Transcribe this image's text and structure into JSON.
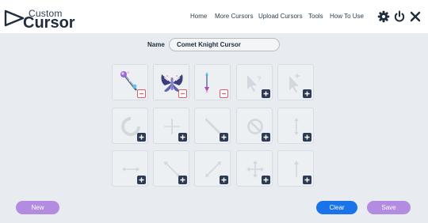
{
  "logo": {
    "line1": "Custom",
    "line2": "Cursor"
  },
  "nav": {
    "items": [
      "Home",
      "More Cursors",
      "Upload Cursors",
      "Tools",
      "How To Use"
    ]
  },
  "header_icons": [
    "gear-icon",
    "power-icon",
    "close-icon"
  ],
  "form": {
    "name_label": "Name",
    "name_value": "Comet Knight Cursor"
  },
  "slots": [
    {
      "icon": "comet-knight-wand-icon",
      "state": "filled",
      "badge": "remove"
    },
    {
      "icon": "comet-knight-butterfly-icon",
      "state": "filled",
      "badge": "remove"
    },
    {
      "icon": "comet-knight-resize-icon",
      "state": "filled",
      "badge": "remove"
    },
    {
      "icon": "help-arrow-icon",
      "state": "empty",
      "badge": "add"
    },
    {
      "icon": "arrow-sparkle-icon",
      "state": "empty",
      "badge": "add"
    },
    {
      "icon": "busy-ring-icon",
      "state": "empty",
      "badge": "add"
    },
    {
      "icon": "crosshair-icon",
      "state": "empty",
      "badge": "add"
    },
    {
      "icon": "pen-icon",
      "state": "empty",
      "badge": "add"
    },
    {
      "icon": "not-allowed-icon",
      "state": "empty",
      "badge": "add"
    },
    {
      "icon": "vertical-resize-icon",
      "state": "empty",
      "badge": "add"
    },
    {
      "icon": "horizontal-resize-icon",
      "state": "empty",
      "badge": "add"
    },
    {
      "icon": "diagonal-resize-nwse-icon",
      "state": "empty",
      "badge": "add"
    },
    {
      "icon": "diagonal-resize-nesw-icon",
      "state": "empty",
      "badge": "add"
    },
    {
      "icon": "move-icon",
      "state": "empty",
      "badge": "add"
    },
    {
      "icon": "up-arrow-icon",
      "state": "empty",
      "badge": "add"
    }
  ],
  "buttons": {
    "new": "New",
    "clear": "Clear",
    "save": "Save"
  },
  "colors": {
    "purple": "#b38be0",
    "blue": "#1a73e8",
    "navy": "#2c3a55",
    "remove": "#e05a6a"
  }
}
